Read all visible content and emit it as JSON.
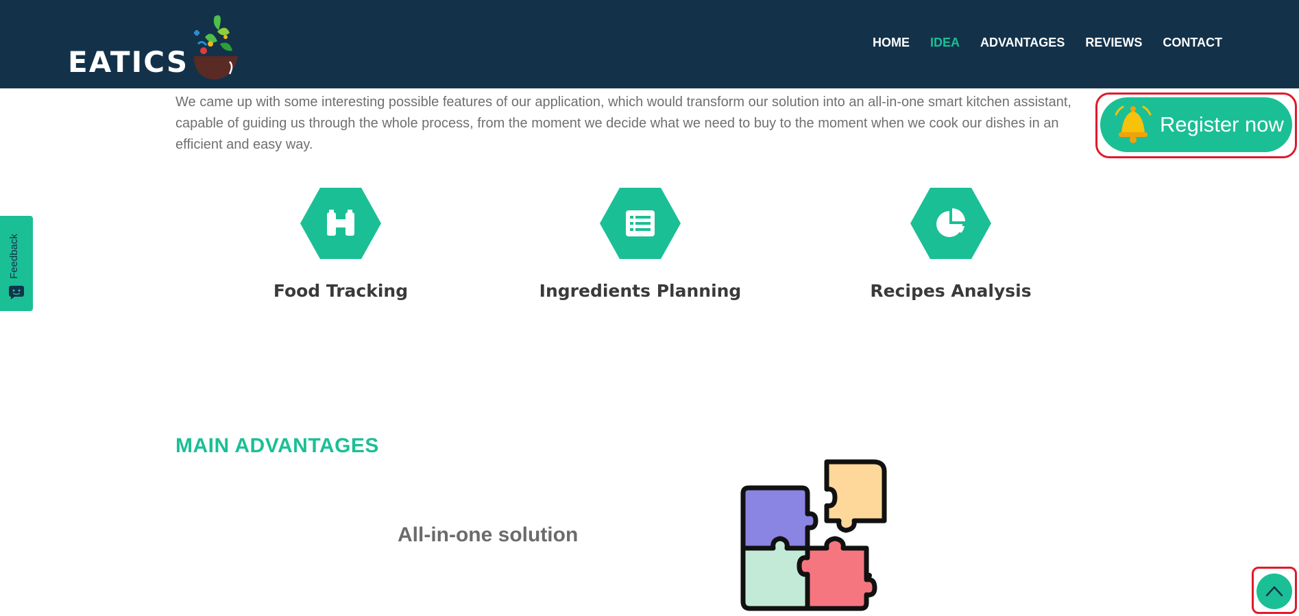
{
  "brand": {
    "name": "EATICS"
  },
  "nav": {
    "items": [
      {
        "label": "HOME"
      },
      {
        "label": "IDEA"
      },
      {
        "label": "ADVANTAGES"
      },
      {
        "label": "REVIEWS"
      },
      {
        "label": "CONTACT"
      }
    ],
    "active": "IDEA"
  },
  "intro": {
    "text": "We came up with some interesting possible features of our application, which would transform our solution into an all-in-one smart kitchen assistant, capable of guiding us through the whole process, from the moment we decide what we need to buy to the moment when we cook our dishes in an efficient and easy way."
  },
  "register": {
    "label": "Register now",
    "icon": "bell-icon"
  },
  "feedback": {
    "label": "Feedback",
    "icon": "chat-face-icon"
  },
  "features": [
    {
      "title": "Food Tracking",
      "icon": "binoculars-icon"
    },
    {
      "title": "Ingredients Planning",
      "icon": "list-icon"
    },
    {
      "title": "Recipes Analysis",
      "icon": "pie-chart-icon"
    }
  ],
  "advantages": {
    "heading": "MAIN ADVANTAGES",
    "item_title": "All-in-one solution",
    "item_icon": "puzzle-icon"
  },
  "back_to_top": {
    "icon": "chevron-up-icon"
  },
  "colors": {
    "header_bg": "#13324a",
    "accent": "#1bbf95",
    "highlight_outline": "#e0192b",
    "text_gray": "#6f6f6f",
    "title_dark": "#3a3a3a"
  }
}
